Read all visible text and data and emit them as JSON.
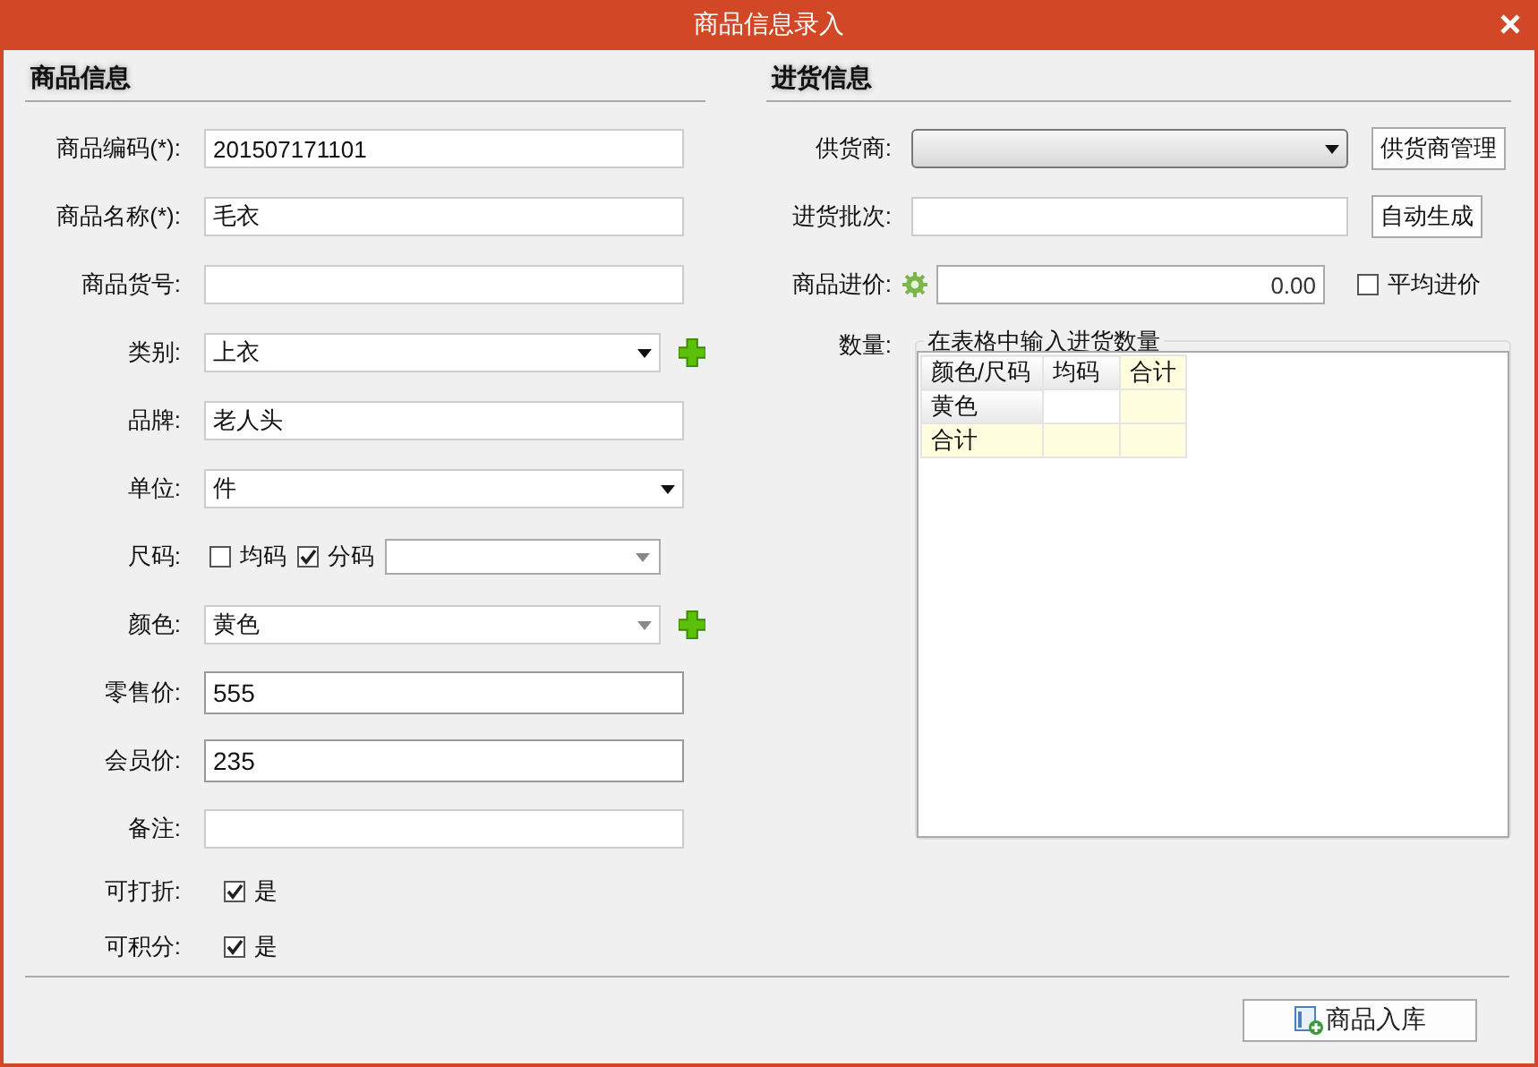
{
  "window": {
    "title": "商品信息录入"
  },
  "goods": {
    "heading": "商品信息",
    "fields": [
      {
        "kind": "text",
        "label": "商品编码(*):",
        "value": "201507171101"
      },
      {
        "kind": "text",
        "label": "商品名称(*):",
        "value": "毛衣"
      },
      {
        "kind": "text",
        "label": "商品货号:"
      },
      {
        "kind": "select",
        "label": "类别:",
        "value": "上衣",
        "add": true
      },
      {
        "kind": "text",
        "label": "品牌:",
        "value": "老人头"
      },
      {
        "kind": "select",
        "label": "单位:",
        "value": "件"
      },
      {
        "kind": "size",
        "label": "尺码:",
        "options": [
          {
            "label": "均码",
            "checked": false
          },
          {
            "label": "分码",
            "checked": true
          }
        ]
      },
      {
        "kind": "select",
        "label": "颜色:",
        "value": "黄色",
        "add": true
      },
      {
        "kind": "number",
        "label": "零售价:",
        "value": "555"
      },
      {
        "kind": "number",
        "label": "会员价:",
        "value": "235"
      },
      {
        "kind": "text",
        "label": "备注:"
      },
      {
        "kind": "check",
        "label": "可打折:",
        "text": "是",
        "checked": true
      },
      {
        "kind": "check",
        "label": "可积分:",
        "text": "是",
        "checked": true
      }
    ]
  },
  "purchase": {
    "heading": "进货信息",
    "supplier": {
      "label": "供货商:",
      "button": "供货商管理"
    },
    "batch": {
      "label": "进货批次:",
      "button": "自动生成"
    },
    "price": {
      "label": "商品进价:",
      "value": "0.00",
      "average": {
        "label": "平均进价",
        "checked": false
      }
    },
    "quantity": {
      "label": "数量:",
      "legend": "在表格中输入进货数量",
      "columns": [
        "颜色/尺码",
        "均码",
        "合计"
      ],
      "rows": [
        {
          "kind": "item",
          "label": "黄色"
        },
        {
          "kind": "total",
          "label": "合计"
        }
      ]
    }
  },
  "footer": {
    "button": "商品入库"
  }
}
